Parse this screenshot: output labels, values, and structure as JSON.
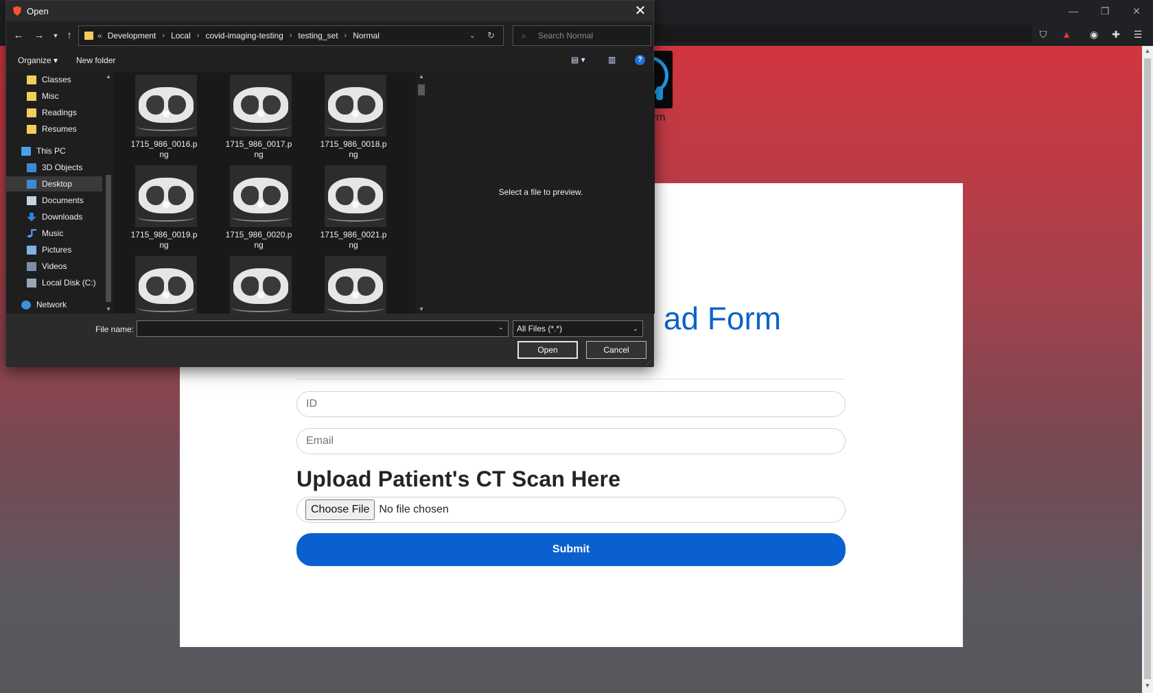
{
  "dialog": {
    "title": "Open",
    "breadcrumb": {
      "overflow": "«",
      "parts": [
        "Development",
        "Local",
        "covid-imaging-testing",
        "testing_set",
        "Normal"
      ]
    },
    "search_placeholder": "Search Normal",
    "organize_label": "Organize ▾",
    "new_folder_label": "New folder",
    "nav": {
      "items": [
        {
          "label": "Classes"
        },
        {
          "label": "Misc"
        },
        {
          "label": "Readings"
        },
        {
          "label": "Resumes"
        },
        {
          "label": "This PC"
        },
        {
          "label": "3D Objects"
        },
        {
          "label": "Desktop"
        },
        {
          "label": "Documents"
        },
        {
          "label": "Downloads"
        },
        {
          "label": "Music"
        },
        {
          "label": "Pictures"
        },
        {
          "label": "Videos"
        },
        {
          "label": "Local Disk (C:)"
        },
        {
          "label": "Network"
        }
      ],
      "selected": "Desktop"
    },
    "files": [
      {
        "line1": "1715_986_0016.p",
        "line2": "ng"
      },
      {
        "line1": "1715_986_0017.p",
        "line2": "ng"
      },
      {
        "line1": "1715_986_0018.p",
        "line2": "ng"
      },
      {
        "line1": "1715_986_0019.p",
        "line2": "ng"
      },
      {
        "line1": "1715_986_0020.p",
        "line2": "ng"
      },
      {
        "line1": "1715_986_0021.p",
        "line2": "ng"
      },
      {
        "line1": "",
        "line2": ""
      },
      {
        "line1": "",
        "line2": ""
      },
      {
        "line1": "",
        "line2": ""
      }
    ],
    "preview_message": "Select a file to preview.",
    "file_name_label": "File name:",
    "file_name_value": "",
    "file_type": "All Files (*.*)",
    "open_label": "Open",
    "cancel_label": "Cancel"
  },
  "page": {
    "logo_text": "orm",
    "form_title_visible": "ad Form",
    "id_placeholder": "ID",
    "email_placeholder": "Email",
    "upload_heading": "Upload Patient's CT Scan Here",
    "choose_file_label": "Choose File",
    "no_file_text": "No file chosen",
    "submit_label": "Submit"
  },
  "colors": {
    "accent": "#0a60cf",
    "title_blue": "#0d63c9"
  }
}
